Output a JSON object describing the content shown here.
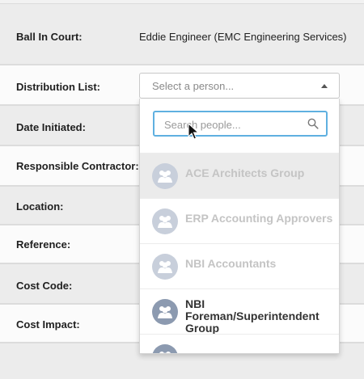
{
  "form": {
    "ball_in_court": {
      "label": "Ball In Court:",
      "value": "Eddie Engineer (EMC Engineering Services)"
    },
    "distribution_list": {
      "label": "Distribution List:",
      "placeholder": "Select a person..."
    },
    "date_initiated": {
      "label": "Date Initiated:"
    },
    "responsible_contractor": {
      "label": "Responsible Contractor:"
    },
    "location": {
      "label": "Location:"
    },
    "reference": {
      "label": "Reference:"
    },
    "cost_code": {
      "label": "Cost Code:"
    },
    "cost_impact": {
      "label": "Cost Impact:"
    }
  },
  "dropdown": {
    "search_placeholder": "Search people...",
    "search_icon": "magnifier-icon",
    "options": [
      {
        "label": "ACE Architects Group",
        "icon": "group-avatar-icon"
      },
      {
        "label": "ERP Accounting Approvers",
        "icon": "group-avatar-icon"
      },
      {
        "label": "NBI Accountants",
        "icon": "group-avatar-icon"
      },
      {
        "label": "NBI Foreman/Superintendent Group",
        "icon": "group-avatar-icon"
      }
    ]
  },
  "colors": {
    "focus_border": "#5fb0e0",
    "avatar": "#8c9ab0",
    "row_alt": "#ececec"
  }
}
